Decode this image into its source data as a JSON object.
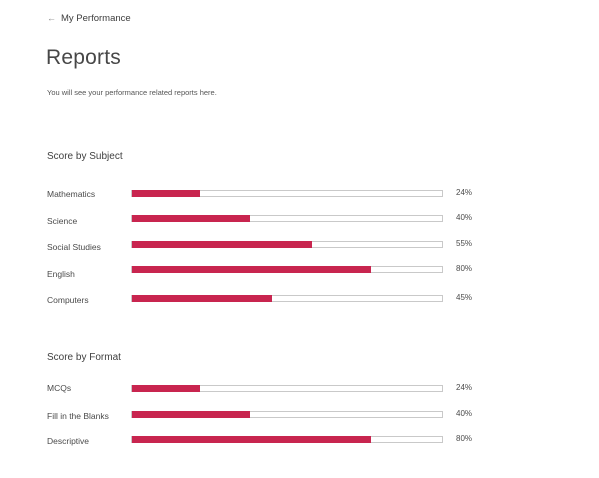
{
  "header": {
    "back_label": "My Performance",
    "back_icon": "arrow-left-icon",
    "title": "Reports",
    "subtitle": "You will see your performance related reports here."
  },
  "colors": {
    "bar_fill": "#c8254f",
    "bar_border": "#c9c9c9"
  },
  "sections": [
    {
      "title": "Score by Subject",
      "rows": [
        {
          "label": "Mathematics",
          "value": "24%",
          "percent": 22
        },
        {
          "label": "Science",
          "value": "40%",
          "percent": 38
        },
        {
          "label": "Social Studies",
          "value": "55%",
          "percent": 58
        },
        {
          "label": "English",
          "value": "80%",
          "percent": 77
        },
        {
          "label": "Computers",
          "value": "45%",
          "percent": 45
        }
      ]
    },
    {
      "title": "Score by Format",
      "rows": [
        {
          "label": "MCQs",
          "value": "24%",
          "percent": 22
        },
        {
          "label": "Fill in the Blanks",
          "value": "40%",
          "percent": 38
        },
        {
          "label": "Descriptive",
          "value": "80%",
          "percent": 77
        }
      ]
    }
  ]
}
